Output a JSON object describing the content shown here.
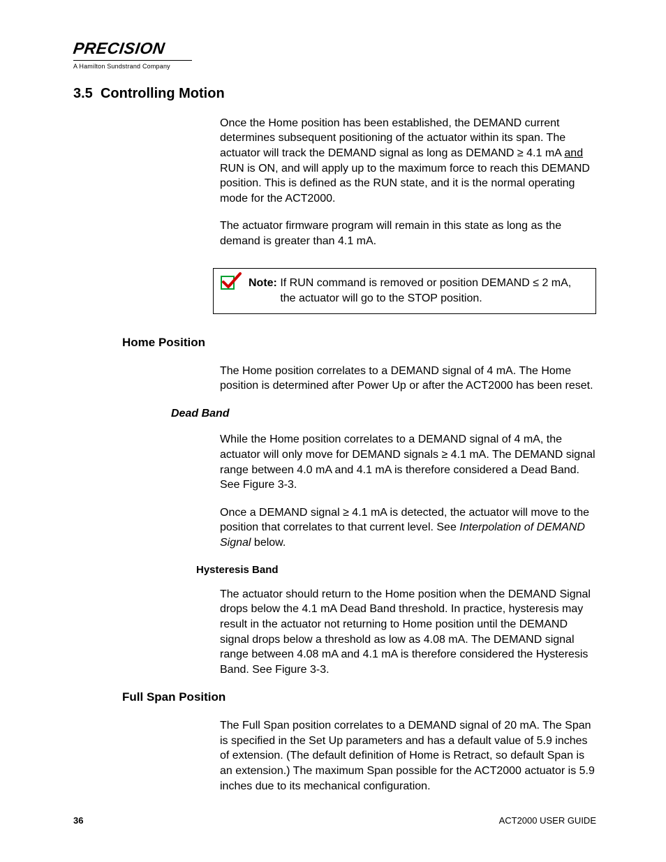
{
  "logo": {
    "brand": "PRECISION",
    "tagline": "A Hamilton Sundstrand Company"
  },
  "section": {
    "number": "3.5",
    "title": "Controlling Motion"
  },
  "intro": {
    "p1a": "Once the Home position has been established, the DEMAND current determines subsequent positioning of the actuator within its span. The actuator will track the DEMAND signal as long as DEMAND ≥ 4.1 mA ",
    "p1_and": "and",
    "p1b": " RUN is ON, and will apply up to the maximum force to reach this DEMAND position. This is defined as the RUN state, and it is the normal operating mode for the ACT2000.",
    "p2": "The actuator firmware program will remain in this state as long as the demand is greater than 4.1 mA."
  },
  "note": {
    "label": "Note: ",
    "line1": "If RUN command is removed or position DEMAND ≤ 2 mA,",
    "line2": "the actuator will go to the STOP position."
  },
  "home": {
    "heading": "Home Position",
    "p1": "The Home position correlates to a DEMAND signal of 4 mA. The Home position is determined after Power Up or after the ACT2000 has been reset."
  },
  "deadband": {
    "heading": "Dead Band",
    "p1": "While the Home position correlates to a DEMAND signal of 4 mA, the actuator will only move for DEMAND signals ≥ 4.1 mA. The DEMAND signal range between 4.0 mA and 4.1 mA is therefore considered a Dead Band. See Figure 3-3.",
    "p2a": "Once a DEMAND signal ≥ 4.1 mA is detected, the actuator will move to the position that correlates to that current level. See ",
    "p2_ref": "Interpolation of DEMAND Signal",
    "p2b": " below."
  },
  "hysteresis": {
    "heading": "Hysteresis Band",
    "p1": "The actuator should return to the Home position when the DEMAND Signal drops below the 4.1 mA Dead Band threshold. In practice, hysteresis may result in the actuator not returning to Home position until the DEMAND signal drops below a threshold as low as 4.08 mA.  The DEMAND signal range between 4.08 mA and 4.1 mA is therefore considered the Hysteresis Band. See Figure 3-3."
  },
  "fullspan": {
    "heading": "Full Span Position",
    "p1": "The Full Span position correlates to a DEMAND signal of 20 mA. The Span is specified in the Set Up parameters and has a default value of 5.9 inches of extension. (The default definition of Home is Retract, so default Span is an extension.) The maximum Span possible for the ACT2000 actuator is 5.9 inches due to its mechanical configuration."
  },
  "footer": {
    "page": "36",
    "doc": "ACT2000 USER GUIDE"
  }
}
